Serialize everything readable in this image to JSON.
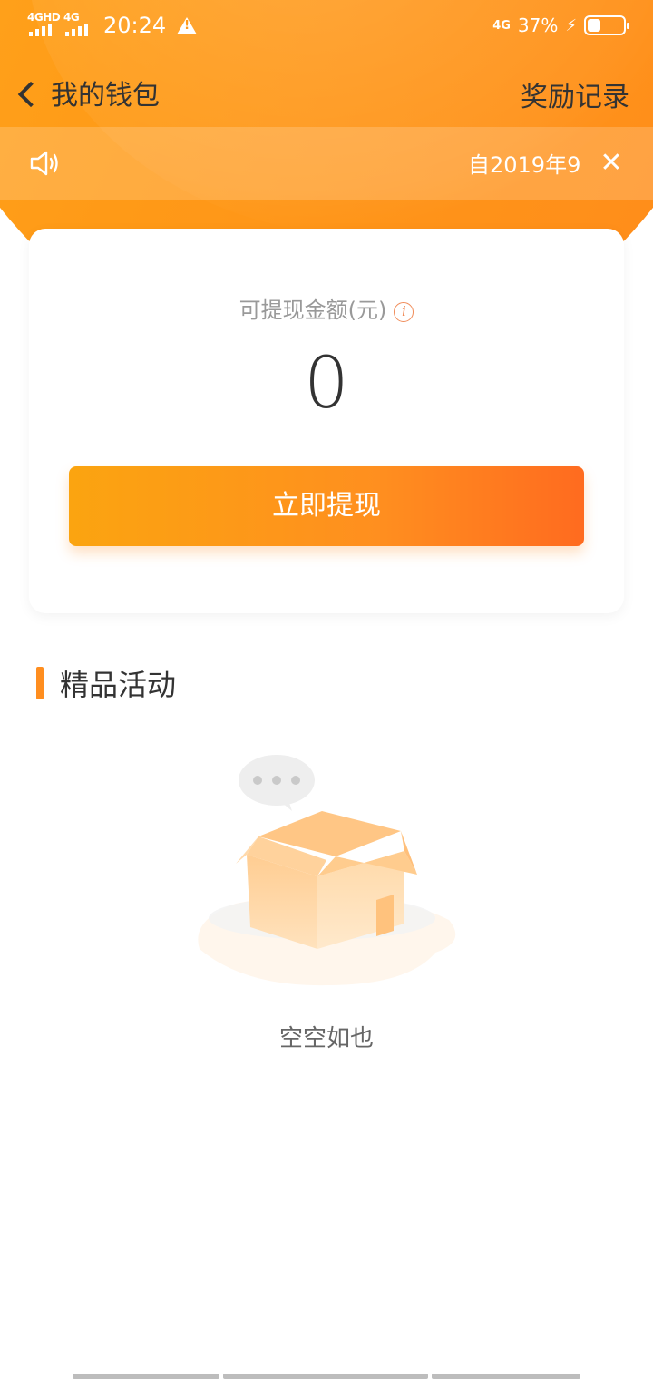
{
  "status_bar": {
    "sim1_label": "4GHD",
    "sim2_label": "4G",
    "time": "20:24",
    "network_label": "4G",
    "battery_percent": "37%",
    "battery_level": 0.37
  },
  "nav": {
    "title": "我的钱包",
    "right_link": "奖励记录"
  },
  "notice": {
    "text": "自2019年9",
    "close_label": "✕"
  },
  "balance": {
    "label": "可提现金额(元)",
    "info_icon": "i",
    "amount": "0",
    "withdraw_button": "立即提现"
  },
  "section": {
    "title": "精品活动"
  },
  "empty_state": {
    "text": "空空如也",
    "icon": "empty-box-icon"
  },
  "colors": {
    "brand_orange": "#ff9a17",
    "button_start": "#fba410",
    "button_end": "#ff6b1f",
    "accent_bar": "#ff8e1f"
  }
}
